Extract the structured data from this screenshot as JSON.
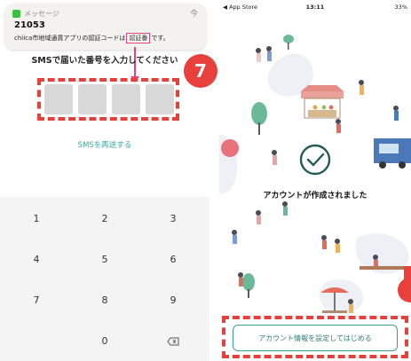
{
  "left": {
    "notification": {
      "app_name": "メッセージ",
      "more": "今",
      "code": "21053",
      "body_prefix": "chiica市地域通貨アプリの認証コードは",
      "body_code": "認証番",
      "body_suffix": "です。"
    },
    "title": "SMSで届いた番号を入力してください",
    "resend_link": "SMSを再送する",
    "step_badge": "7",
    "keypad": [
      "1",
      "2",
      "3",
      "4",
      "5",
      "6",
      "7",
      "8",
      "9",
      "0"
    ],
    "backspace_icon": "backspace-icon"
  },
  "right": {
    "status": {
      "back": "◀ App Store",
      "time": "13:11",
      "battery": "33%"
    },
    "check_icon": "checkmark-circle-icon",
    "done_text": "アカウントが作成されました",
    "setup_button": "アカウント情報を設定してはじめる"
  },
  "colors": {
    "accent": "#3aa8a0",
    "highlight": "#e3413c",
    "pink": "#e8417a"
  }
}
